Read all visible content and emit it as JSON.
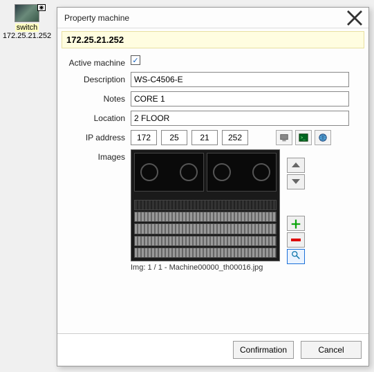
{
  "desktop": {
    "icon_label": "switch",
    "icon_ip": "172.25.21.252"
  },
  "window": {
    "title": "Property machine",
    "header_ip": "172.25.21.252"
  },
  "labels": {
    "active": "Active machine",
    "description": "Description",
    "notes": "Notes",
    "location": "Location",
    "ip": "IP address",
    "images": "Images"
  },
  "values": {
    "active_checked": "✓",
    "description": "WS-C4506-E",
    "notes": "CORE 1",
    "location": "2 FLOOR",
    "ip_octets": [
      "172",
      "25",
      "21",
      "252"
    ]
  },
  "image": {
    "caption": "Img: 1 / 1 - Machine00000_th00016.jpg"
  },
  "icons": {
    "monitor": "monitor-icon",
    "terminal": "terminal-icon",
    "globe": "globe-icon",
    "up": "arrow-up-icon",
    "down": "arrow-down-icon",
    "add": "plus-icon",
    "remove": "minus-icon",
    "zoom": "magnify-icon",
    "close": "close-icon"
  },
  "buttons": {
    "confirm": "Confirmation",
    "cancel": "Cancel"
  }
}
